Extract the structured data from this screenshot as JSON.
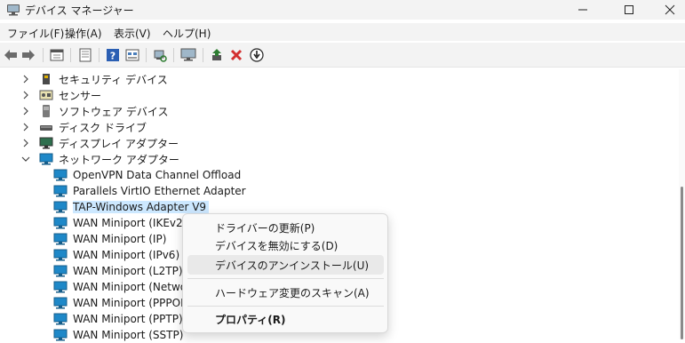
{
  "window": {
    "title": "デバイス マネージャー",
    "controls": [
      "minimize",
      "maximize",
      "close"
    ]
  },
  "menubar": {
    "items": [
      "ファイル(F)",
      "操作(A)",
      "表示(V)",
      "ヘルプ(H)"
    ]
  },
  "toolbar": {
    "buttons": [
      "back-icon",
      "forward-icon",
      "properties-icon",
      "help-topics-icon",
      "help-icon",
      "view-icon",
      "scan-hardware-icon",
      "monitor-icon",
      "update-driver-icon",
      "uninstall-icon",
      "disable-icon"
    ]
  },
  "tree": {
    "categories": [
      {
        "label": "セキュリティ デバイス",
        "expanded": false
      },
      {
        "label": "センサー",
        "expanded": false
      },
      {
        "label": "ソフトウェア デバイス",
        "expanded": false
      },
      {
        "label": "ディスク ドライブ",
        "expanded": false
      },
      {
        "label": "ディスプレイ アダプター",
        "expanded": false
      },
      {
        "label": "ネットワーク アダプター",
        "expanded": true
      }
    ],
    "network_adapters": [
      "OpenVPN Data Channel Offload",
      "Parallels VirtIO Ethernet Adapter",
      "TAP-Windows Adapter V9",
      "WAN Miniport (IKEv2)",
      "WAN Miniport (IP)",
      "WAN Miniport (IPv6)",
      "WAN Miniport (L2TP)",
      "WAN Miniport (Networ",
      "WAN Miniport (PPPOE)",
      "WAN Miniport (PPTP)",
      "WAN Miniport (SSTP)"
    ],
    "selected": "TAP-Windows Adapter V9"
  },
  "context_menu": {
    "update_driver": "ドライバーの更新(P)",
    "disable_device": "デバイスを無効にする(D)",
    "uninstall_device": "デバイスのアンインストール(U)",
    "scan_hardware": "ハードウェア変更のスキャン(A)",
    "properties": "プロパティ(R)",
    "hovered": "デバイスのアンインストール(U)"
  },
  "colors": {
    "selection": "#cce8ff",
    "uninstall_red": "#d32f2f",
    "update_green": "#2e7d32",
    "network_blue": "#1e88c8"
  }
}
